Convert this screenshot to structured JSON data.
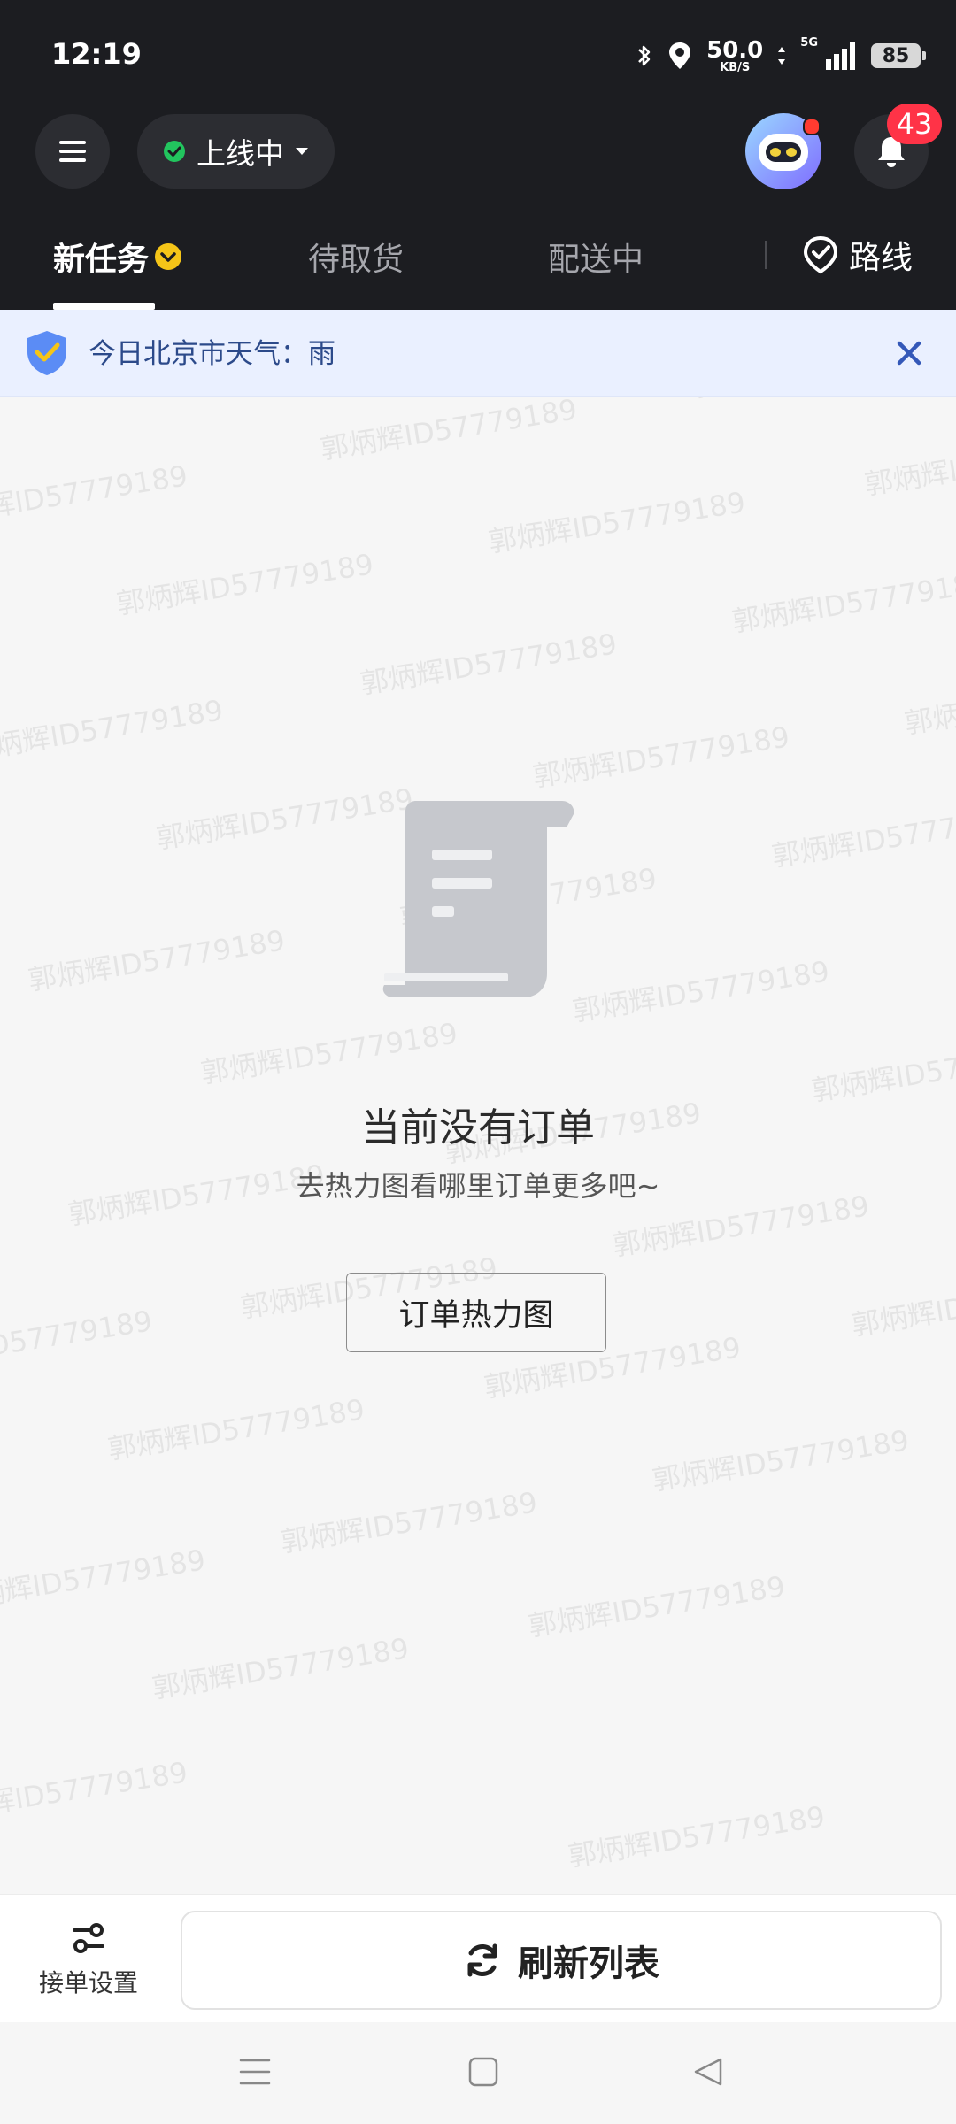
{
  "status_bar": {
    "time": "12:19",
    "net_speed": "50.0",
    "net_speed_unit": "KB/S",
    "net_type": "5G",
    "battery": "85",
    "icons": [
      "bluetooth-icon",
      "location-icon",
      "signal-icon",
      "battery-icon"
    ]
  },
  "top_bar": {
    "online_status": "上线中",
    "notification_count": "43"
  },
  "tabs": [
    {
      "label": "新任务",
      "active": true
    },
    {
      "label": "待取货",
      "active": false
    },
    {
      "label": "配送中",
      "active": false
    }
  ],
  "route": {
    "label": "路线"
  },
  "notice": {
    "text": "今日北京市天气：雨"
  },
  "watermark": {
    "text": "郭炳辉ID57779189"
  },
  "empty_state": {
    "title": "当前没有订单",
    "subtitle": "去热力图看哪里订单更多吧~",
    "button_label": "订单热力图"
  },
  "bottom_bar": {
    "settings_label": "接单设置",
    "refresh_label": "刷新列表"
  },
  "colors": {
    "header_bg": "#1c1d21",
    "online_green": "#22c55e",
    "badge_red": "#ff3347",
    "notice_bg": "#eaf0ff",
    "accent_yellow": "#f5c518"
  }
}
